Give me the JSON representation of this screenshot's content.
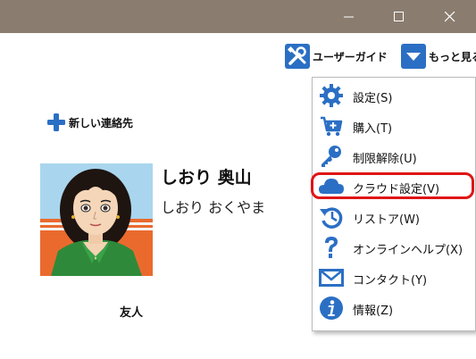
{
  "window": {
    "buttons": [
      "minimize",
      "maximize",
      "close"
    ]
  },
  "toolbar": {
    "guide_label": "ユーザーガイド",
    "more_label": "もっと見る"
  },
  "new_contact_label": "新しい連絡先",
  "contact": {
    "name": "しおり 奥山",
    "kana": "しおり おくやま",
    "group": "友人"
  },
  "menu": {
    "items": [
      {
        "label": "設定(S)",
        "icon": "gear-icon"
      },
      {
        "label": "購入(T)",
        "icon": "cart-icon"
      },
      {
        "label": "制限解除(U)",
        "icon": "key-icon"
      },
      {
        "label": "クラウド設定(V)",
        "icon": "cloud-icon",
        "highlighted": true
      },
      {
        "label": "リストア(W)",
        "icon": "restore-icon"
      },
      {
        "label": "オンラインヘルプ(X)",
        "icon": "question-icon"
      },
      {
        "label": "コンタクト(Y)",
        "icon": "envelope-icon"
      },
      {
        "label": "情報(Z)",
        "icon": "info-icon"
      }
    ]
  },
  "colors": {
    "titlebar": "#8a7d6f",
    "icon_blue": "#2b6fc4",
    "highlight_red": "#e01515"
  }
}
